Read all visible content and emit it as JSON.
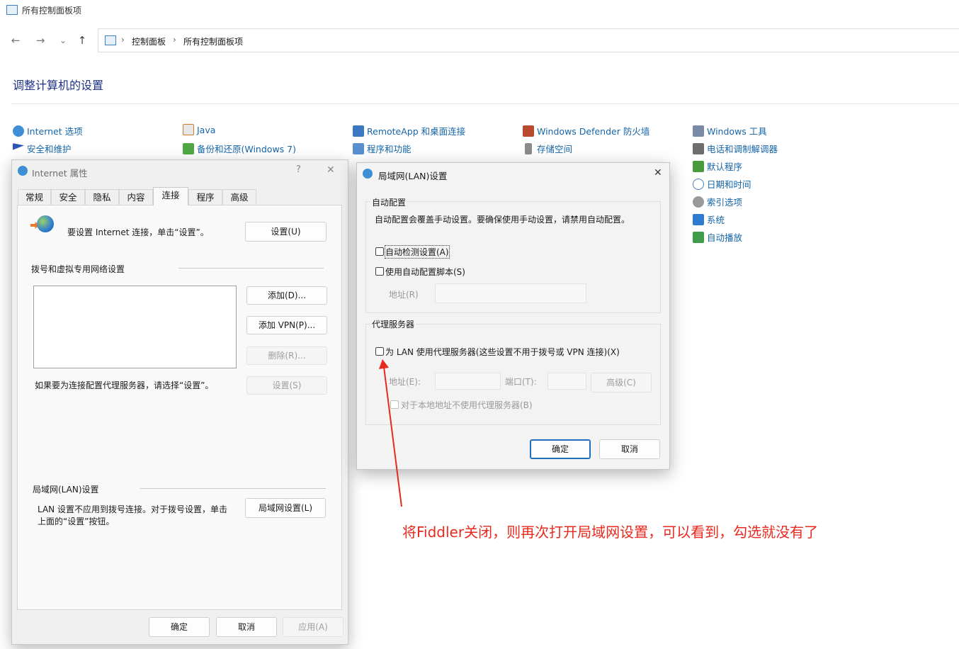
{
  "window": {
    "title": "所有控制面板项"
  },
  "nav": {
    "back": "←",
    "forward": "→",
    "recent": "⌄",
    "up": "↑"
  },
  "address": {
    "crumb1": "控制面板",
    "crumb2": "所有控制面板项",
    "sep": "›"
  },
  "heading": "调整计算机的设置",
  "cp_items": [
    {
      "label": "Internet 选项",
      "icon": "internet-options-icon"
    },
    {
      "label": "安全和维护",
      "icon": "flag-icon"
    },
    {
      "label": "Java",
      "icon": "java-icon"
    },
    {
      "label": "备份和还原(Windows 7)",
      "icon": "backup-icon"
    },
    {
      "label": "RemoteApp 和桌面连接",
      "icon": "remoteapp-icon"
    },
    {
      "label": "程序和功能",
      "icon": "programs-icon"
    },
    {
      "label": "Windows Defender 防火墙",
      "icon": "firewall-icon"
    },
    {
      "label": "存储空间",
      "icon": "storage-icon"
    },
    {
      "label": "Windows 工具",
      "icon": "tools-icon"
    },
    {
      "label": "电话和调制解调器",
      "icon": "phone-modem-icon"
    },
    {
      "label": "默认程序",
      "icon": "default-programs-icon"
    },
    {
      "label": "日期和时间",
      "icon": "clock-icon"
    },
    {
      "label": "索引选项",
      "icon": "indexing-icon"
    },
    {
      "label": "系统",
      "icon": "system-icon"
    },
    {
      "label": "自动播放",
      "icon": "autoplay-icon"
    }
  ],
  "inet_dialog": {
    "title": "Internet 属性",
    "help": "?",
    "close": "✕",
    "tabs": [
      "常规",
      "安全",
      "隐私",
      "内容",
      "连接",
      "程序",
      "高级"
    ],
    "setup_text": "要设置 Internet 连接，单击“设置”。",
    "setup_button": "设置(U)",
    "dialup_label": "拨号和虚拟专用网络设置",
    "add_button": "添加(D)...",
    "add_vpn_button": "添加 VPN(P)...",
    "remove_button": "删除(R)...",
    "settings_button": "设置(S)",
    "proxy_note": "如果要为连接配置代理服务器，请选择“设置”。",
    "lan_label": "局域网(LAN)设置",
    "lan_note_1": "LAN 设置不应用到拨号连接。对于拨号设置，单击",
    "lan_note_2": "上面的“设置”按钮。",
    "lan_button": "局域网设置(L)",
    "ok": "确定",
    "cancel": "取消",
    "apply": "应用(A)"
  },
  "lan_dialog": {
    "title": "局域网(LAN)设置",
    "close": "✕",
    "auto_group": "自动配置",
    "auto_note": "自动配置会覆盖手动设置。要确保使用手动设置，请禁用自动配置。",
    "auto_detect": "自动检测设置(A)",
    "auto_script": "使用自动配置脚本(S)",
    "address_label": "地址(R)",
    "proxy_group": "代理服务器",
    "use_proxy": "为 LAN 使用代理服务器(这些设置不用于拨号或 VPN 连接)(X)",
    "proxy_address_label": "地址(E):",
    "port_label": "端口(T):",
    "advanced_button": "高级(C)",
    "bypass_local": "对于本地地址不使用代理服务器(B)",
    "ok": "确定",
    "cancel": "取消",
    "checked": {
      "auto_detect": false,
      "auto_script": false,
      "use_proxy": false,
      "bypass_local": false
    }
  },
  "annotation": "将Fiddler关闭，则再次打开局域网设置，可以看到，勾选就没有了",
  "colors": {
    "link": "#1565a8",
    "heading": "#1e3287",
    "annotation": "#e8291e",
    "accent": "#1f6fbf"
  }
}
